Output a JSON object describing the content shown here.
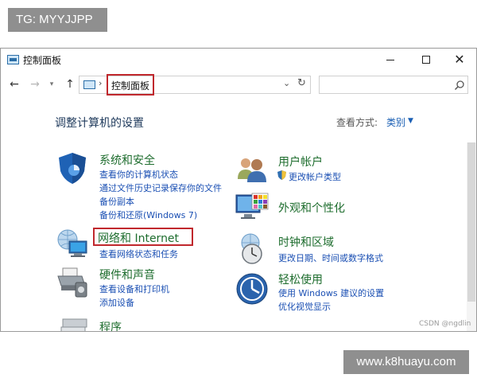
{
  "watermarks": {
    "top_left": "TG: MYYJJPP",
    "bottom_right": "www.k8huayu.com",
    "csdn": "CSDN @ngdlin"
  },
  "window": {
    "title": "控制面板",
    "buttons": {
      "minimize": "",
      "maximize": "",
      "close": "✕"
    }
  },
  "navigation": {
    "back_icon": "←",
    "forward_icon": "→",
    "recent_icon": "▾",
    "up_icon": "↑",
    "breadcrumb_separator": "›",
    "breadcrumb": "控制面板",
    "dropdown_icon": "⌄",
    "refresh_icon": "↻",
    "search_placeholder": ""
  },
  "content": {
    "heading": "调整计算机的设置",
    "view_by_label": "查看方式:",
    "view_by_value": "类别",
    "view_by_caret": "▼"
  },
  "categories": {
    "system_security": {
      "title": "系统和安全",
      "links": [
        "查看你的计算机状态",
        "通过文件历史记录保存你的文件",
        "备份副本",
        "备份和还原(Windows 7)"
      ]
    },
    "network": {
      "title": "网络和 Internet",
      "links": [
        "查看网络状态和任务"
      ]
    },
    "hardware": {
      "title": "硬件和声音",
      "links": [
        "查看设备和打印机",
        "添加设备"
      ]
    },
    "programs": {
      "title": "程序"
    },
    "user_accounts": {
      "title": "用户帐户",
      "links": [
        "更改帐户类型"
      ]
    },
    "appearance": {
      "title": "外观和个性化"
    },
    "clock_region": {
      "title": "时钟和区域",
      "links": [
        "更改日期、时间或数字格式"
      ]
    },
    "ease_of_access": {
      "title": "轻松使用",
      "links": [
        "使用 Windows 建议的设置",
        "优化视觉显示"
      ]
    }
  },
  "colors": {
    "category_title": "#1e6d2e",
    "link": "#1a4fb3",
    "highlight": "#c0282d",
    "heading": "#1e395b"
  }
}
